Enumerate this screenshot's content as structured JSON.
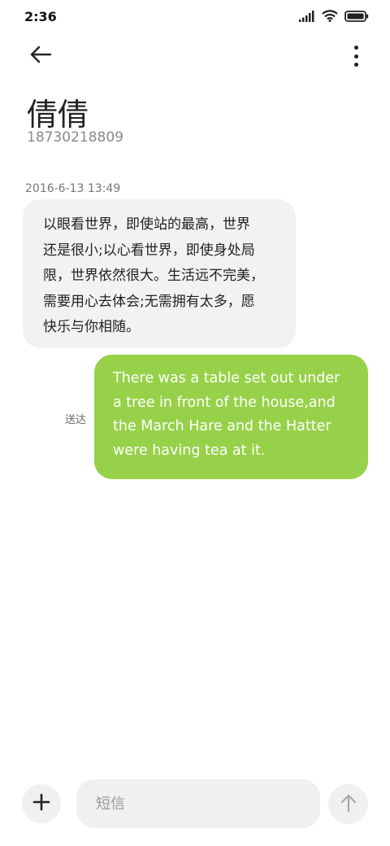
{
  "status_bar": {
    "time": "2:36",
    "icons": [
      "signal-icon",
      "wifi-icon",
      "battery-icon"
    ]
  },
  "header": {
    "back_icon": "back-arrow-icon",
    "menu_icon": "more-vertical-icon"
  },
  "contact": {
    "name": "倩倩",
    "number": "18730218809"
  },
  "conversation": {
    "timestamp": "2016-6-13 13:49",
    "messages": [
      {
        "direction": "incoming",
        "lines": [
          "以眼看世界，即使站的最高，世界",
          "还是很小;以心看世界，即使身处局",
          "限，世界依然很大。生活远不完美，",
          "需要用心去体会;无需拥有太多，愿",
          "快乐与你相随。"
        ]
      },
      {
        "direction": "outgoing",
        "status": "送达",
        "lines": [
          "There was a table set out under",
          "a tree in front of the house,and",
          "the March Hare and the Hatter",
          "were having tea at it."
        ]
      }
    ]
  },
  "composer": {
    "add_icon": "plus-icon",
    "placeholder": "短信",
    "send_icon": "send-arrow-up-icon"
  },
  "colors": {
    "outgoing_bubble": "#97d149",
    "incoming_bubble": "#f2f2f2",
    "composer_bg": "#f0f0f0"
  }
}
